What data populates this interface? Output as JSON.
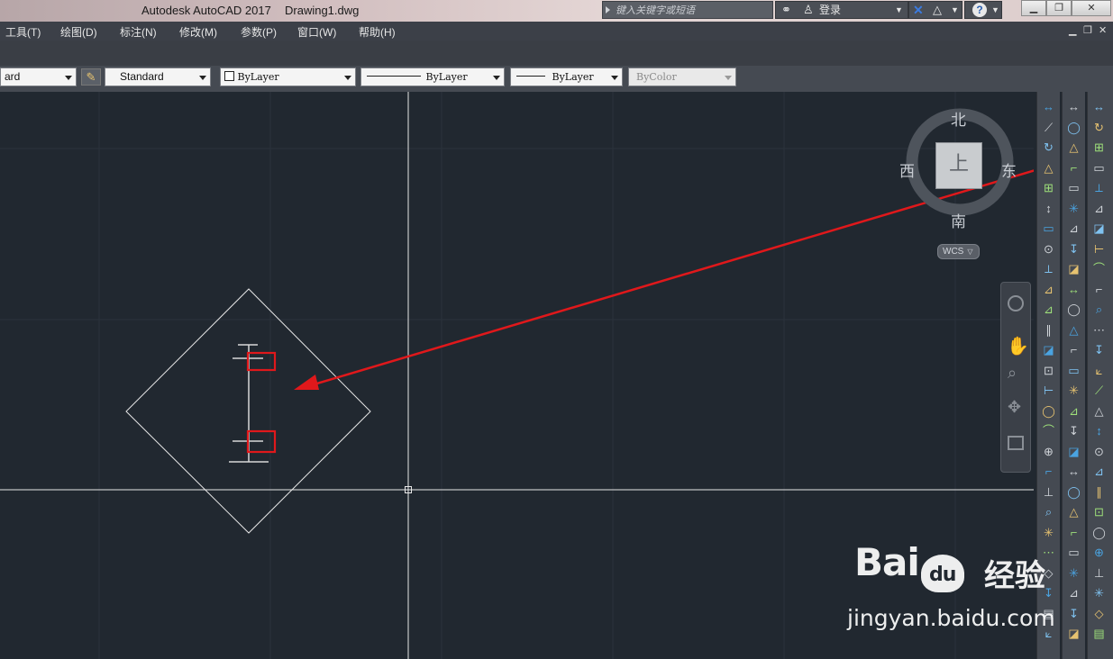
{
  "window": {
    "app_title": "Autodesk AutoCAD 2017",
    "doc_title": "Drawing1.dwg",
    "search_placeholder": "键入关键字或短语",
    "login_label": "登录",
    "help_symbol": "?"
  },
  "menubar": {
    "items": [
      "工具(T)",
      "绘图(D)",
      "标注(N)",
      "修改(M)",
      "参数(P)",
      "窗口(W)",
      "帮助(H)"
    ]
  },
  "properties": {
    "text_style": "ard",
    "dim_style": "Standard",
    "layer_color": "ByLayer",
    "linetype": "ByLayer",
    "lineweight": "ByLayer",
    "plot_style": "ByColor"
  },
  "viewcube": {
    "north": "北",
    "south": "南",
    "east": "东",
    "west": "西",
    "top_face": "上",
    "coord_system": "WCS"
  },
  "watermark": {
    "logo_text": "Bai",
    "logo_suffix": "du",
    "brand_cn": "经验",
    "url": "jingyan.baidu.com"
  },
  "colors": {
    "canvas_bg": "#212830",
    "annotation_red": "#e0181b",
    "drawing_line": "#e8e8e8"
  }
}
